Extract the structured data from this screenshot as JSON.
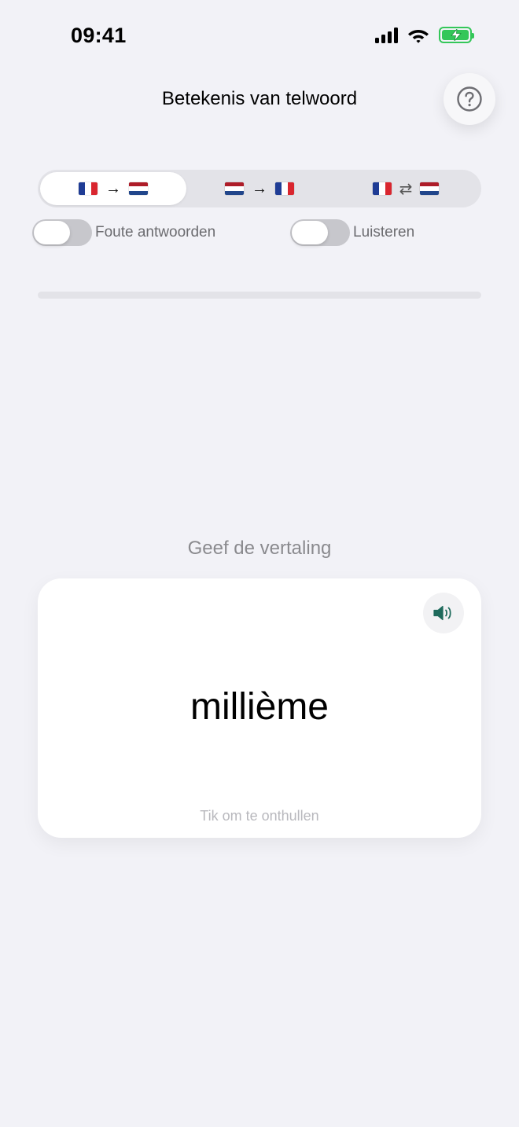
{
  "status_bar": {
    "time": "09:41"
  },
  "header": {
    "title": "Betekenis van telwoord",
    "help_icon": "question-circle-icon"
  },
  "direction_segments": [
    {
      "from": "fr",
      "arrow": "→",
      "to": "nl",
      "selected": true
    },
    {
      "from": "nl",
      "arrow": "→",
      "to": "fr",
      "selected": false
    },
    {
      "from": "fr",
      "arrow": "⇄",
      "to": "nl",
      "selected": false
    }
  ],
  "toggles": {
    "wrong_answers": {
      "label": "Foute antwoorden",
      "on": false
    },
    "listen": {
      "label": "Luisteren",
      "on": false
    }
  },
  "progress": {
    "fraction": 0
  },
  "prompt": "Geef de vertaling",
  "card": {
    "word": "millième",
    "hint": "Tik om te onthullen",
    "speaker_icon": "speaker-icon",
    "accent": "#1F6B5C"
  },
  "colors": {
    "background": "#F2F2F7",
    "battery": "#34C759",
    "toggle_off": "#C7C7CC"
  }
}
